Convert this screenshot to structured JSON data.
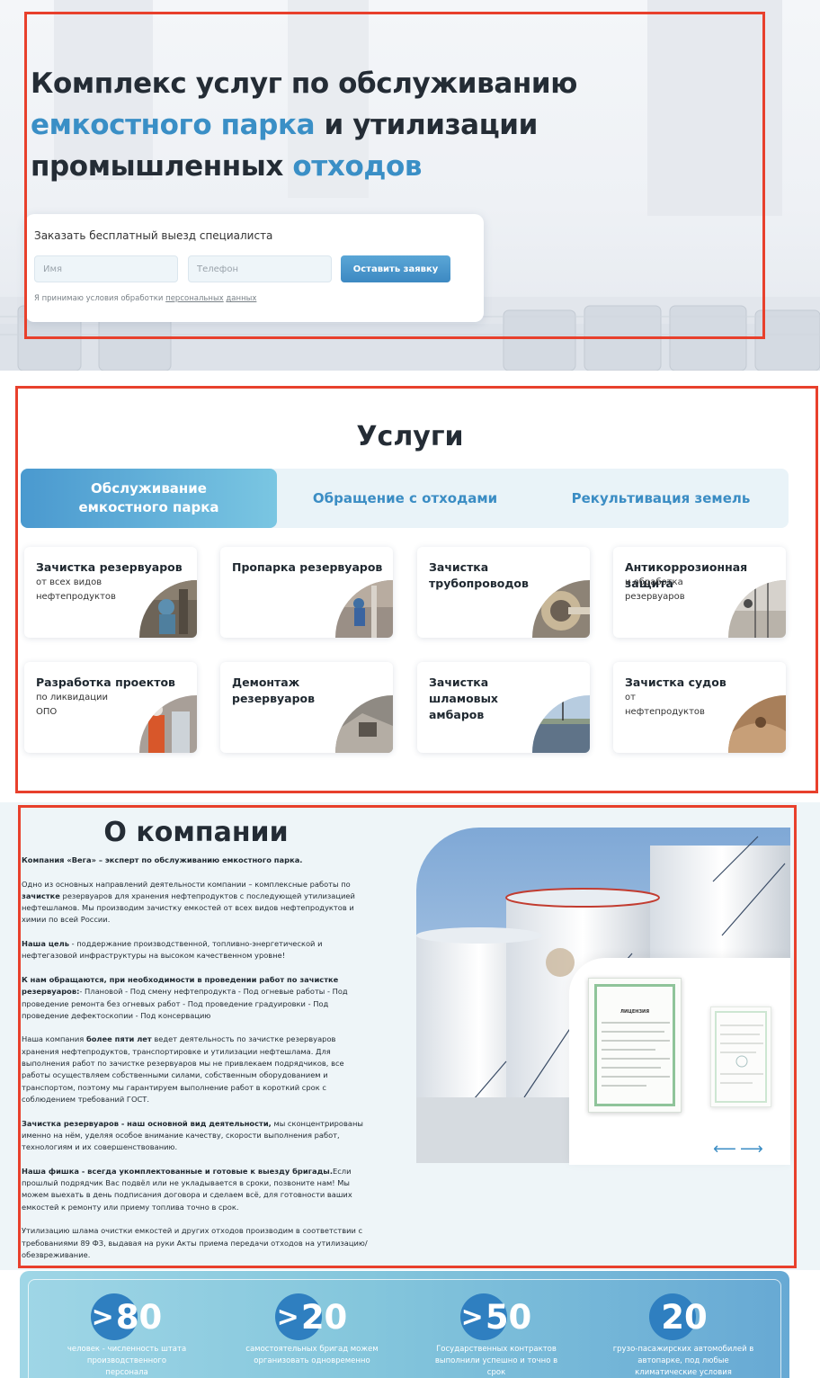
{
  "hero": {
    "title_part1": "Комплекс услуг по обслуживанию",
    "title_highlight1": "емкостного парка",
    "title_part2": " и утилизации",
    "title_part3": "промышленных ",
    "title_highlight2": "отходов",
    "form": {
      "title": "Заказать бесплатный выезд специалиста",
      "name_placeholder": "Имя",
      "phone_placeholder": "Телефон",
      "submit_label": "Оставить заявку",
      "consent_text": "Я принимаю условия обработки ",
      "consent_link1": "персональных",
      "consent_link2": "данных"
    }
  },
  "services": {
    "title": "Услуги",
    "tabs": [
      {
        "label": "Обслуживание емкостного парка",
        "active": true
      },
      {
        "label": "Обращение с отходами",
        "active": false
      },
      {
        "label": "Рекультивация земель",
        "active": false
      }
    ],
    "cards": [
      {
        "title": "Зачистка резервуаров",
        "subtitle": "от всех видов нефтепродуктов"
      },
      {
        "title": "Пропарка резервуаров",
        "subtitle": ""
      },
      {
        "title": "Зачистка трубопроводов",
        "subtitle": ""
      },
      {
        "title": "Антикоррозионная защита",
        "subtitle": "и обработка резервуаров"
      },
      {
        "title": "Разработка проектов",
        "subtitle": "по ликвидации ОПО"
      },
      {
        "title": "Демонтаж резервуаров",
        "subtitle": ""
      },
      {
        "title": "Зачистка шламовых амбаров",
        "subtitle": ""
      },
      {
        "title": "Зачистка судов",
        "subtitle": "от нефтепродуктов"
      }
    ]
  },
  "about": {
    "title": "О компании",
    "p1": "Компания «Вега» – эксперт по обслуживанию емкостного парка.",
    "p2_a": "Одно из основных направлений деятельности компании – комплексные работы по ",
    "p2_b": "зачистке",
    "p2_c": " резервуаров для хранения нефтепродуктов с последующей утилизацией нефтешламов. Мы производим зачистку емкостей от всех видов нефтепродуктов и химии по всей России.",
    "p3_a": "Наша цель",
    "p3_b": " - поддержание производственной, топливно-энергетической и нефтегазовой инфраструктуры на высоком качественном уровне!",
    "p4_a": "К нам обращаются, при необходимости в проведении работ по зачистке резервуаров:",
    "p4_b": "- Плановой - Под смену нефтепродукта - Под огневые работы - Под проведение ремонта без огневых работ - Под проведение градуировки - Под проведение дефектоскопии - Под консервацию",
    "p5_a": "Наша компания ",
    "p5_b": "более пяти лет",
    "p5_c": " ведет деятельность по зачистке резервуаров хранения нефтепродуктов, транспортировке и утилизации нефтешлама. Для выполнения работ по зачистке резервуаров мы не привлекаем подрядчиков, все работы осуществляем собственными силами, собственным оборудованием и транспортом, поэтому мы гарантируем выполнение работ в короткий срок с соблюдением требований ГОСТ.",
    "p6_a": "Зачистка резервуаров - наш основной вид деятельности,",
    "p6_b": " мы сконцентрированы именно на нём, уделяя особое внимание качеству, скорости выполнения работ, технологиям и их совершенствованию.",
    "p7_a": "Наша фишка - всегда укомплектованные и готовые к выезду бригады.",
    "p7_b": "Если прошлый подрядчик Вас подвёл или не укладывается в сроки, позвоните нам! Мы можем выехать в день подписания договора и сделаем всё, для готовности ваших емкостей к ремонту или приему топлива точно в срок.",
    "p8": "Утилизацию шлама очистки емкостей и других отходов производим в соответствии с требованиями 89 ФЗ, выдавая на руки Акты приема передачи отходов на утилизацию/обезвреживание.",
    "cert_label": "ЛИЦЕНЗИЯ",
    "arrow_prev": "⟵",
    "arrow_next": "⟶"
  },
  "stats": [
    {
      "prefix": ">",
      "value": "80",
      "label": "человек - численность штата производственного персонала"
    },
    {
      "prefix": ">",
      "value": "20",
      "label": "самостоятельных бригад можем организовать одновременно"
    },
    {
      "prefix": ">",
      "value": "50",
      "label": "Государственных контрактов выполнили успешно и точно в срок"
    },
    {
      "prefix": "",
      "value": "20",
      "label": "грузо-пасажирских автомобилей в автопарке, под любые климатические условия"
    }
  ],
  "colors": {
    "accent": "#3a8fc6",
    "frame": "#e8402c",
    "heading": "#242c35"
  }
}
